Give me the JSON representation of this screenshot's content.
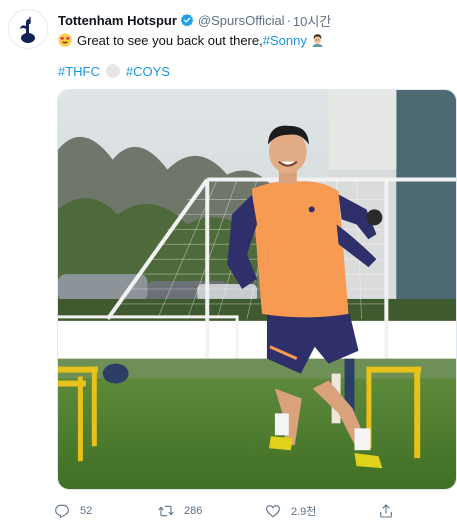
{
  "tweet": {
    "display_name": "Tottenham Hotspur",
    "handle": "@SpursOfficial",
    "separator": "·",
    "time": "10시간",
    "text_before_link": "Great to see you back out there, ",
    "text_link": "#Sonny",
    "tags": [
      "#THFC",
      "#COYS"
    ],
    "media_description": "Video still of a footballer in an orange training top running on a training pitch",
    "stats": {
      "replies": "52",
      "retweets": "286",
      "likes": "2.9천"
    }
  },
  "icons": {
    "avatar": "spurs-cockerel-logo",
    "verified": "verified-badge-icon",
    "reply": "reply-icon",
    "retweet": "retweet-icon",
    "like": "heart-icon",
    "share": "share-icon"
  },
  "colors": {
    "link": "#1b95e0",
    "secondary_text": "#5b7083",
    "verified": "#1da1f2",
    "jersey": "#f79b53",
    "shorts": "#2e2f6b"
  }
}
